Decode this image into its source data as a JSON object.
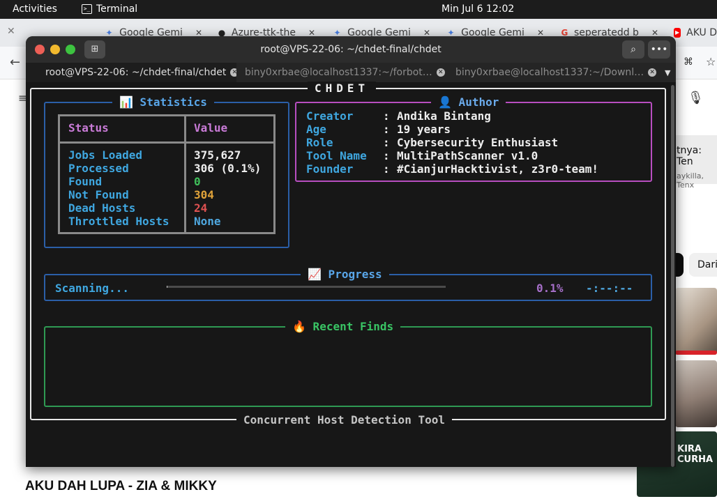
{
  "topbar": {
    "activities": "Activities",
    "app": "Terminal",
    "clock": "Min Jul 6  12:02"
  },
  "browser": {
    "tabs": [
      {
        "label": "Google Gemi",
        "icon": "gemini-icon"
      },
      {
        "label": "Azure-ttk-the",
        "icon": "github-icon"
      },
      {
        "label": "Google Gemi",
        "icon": "gemini-icon"
      },
      {
        "label": "Google Gemi",
        "icon": "gemini-icon"
      },
      {
        "label": "seperatedd b",
        "icon": "google-icon"
      },
      {
        "label": "AKU D",
        "icon": "youtube-icon"
      }
    ],
    "side_text_1": "tnya: Ten",
    "side_text_2": "aykilla, Tenx",
    "chip_label": "Dari",
    "thumb_text": "KIRA CURHA",
    "video_title": "AKU DAH LUPA - ZIA & MIKKY"
  },
  "terminal": {
    "title": "root@VPS-22-06: ~/chdet-final/chdet",
    "tabs": [
      {
        "label": "root@VPS-22-06: ~/chdet-final/chdet",
        "active": true
      },
      {
        "label": "biny0xrbae@localhost1337:~/forbot…",
        "active": false
      },
      {
        "label": "biny0xrbae@localhost1337:~/Downl…",
        "active": false
      }
    ]
  },
  "tui": {
    "header": "CHDET",
    "footer": "Concurrent Host Detection Tool",
    "statistics": {
      "title": "📊 Statistics",
      "col_status": "Status",
      "col_value": "Value",
      "rows": [
        {
          "label": "Jobs Loaded",
          "value": "375,627",
          "color": "#eeeeee"
        },
        {
          "label": "Processed",
          "value": "306 (0.1%)",
          "color": "#eeeeee"
        },
        {
          "label": "Found",
          "value": "0",
          "color": "#3fbf5a"
        },
        {
          "label": "Not Found",
          "value": "304",
          "color": "#e0a33a"
        },
        {
          "label": "Dead Hosts",
          "value": "24",
          "color": "#e05252"
        },
        {
          "label": "Throttled Hosts",
          "value": "None",
          "color": "#4fa8e0"
        }
      ]
    },
    "author": {
      "title": "👤 Author",
      "rows": [
        {
          "key": "Creator",
          "value": "Andika Bintang"
        },
        {
          "key": "Age",
          "value": "19 years"
        },
        {
          "key": "Role",
          "value": "Cybersecurity Enthusiast"
        },
        {
          "key": "Tool Name",
          "value": "MultiPathScanner v1.0"
        },
        {
          "key": "Founder",
          "value": "#CianjurHacktivist, z3r0-team!"
        }
      ]
    },
    "progress": {
      "title": "📈 Progress",
      "label": "Scanning...",
      "percent_text": "0.1%",
      "fraction": 0.001,
      "eta": "-:--:--"
    },
    "recent_finds": {
      "title": "🔥 Recent Finds"
    }
  }
}
